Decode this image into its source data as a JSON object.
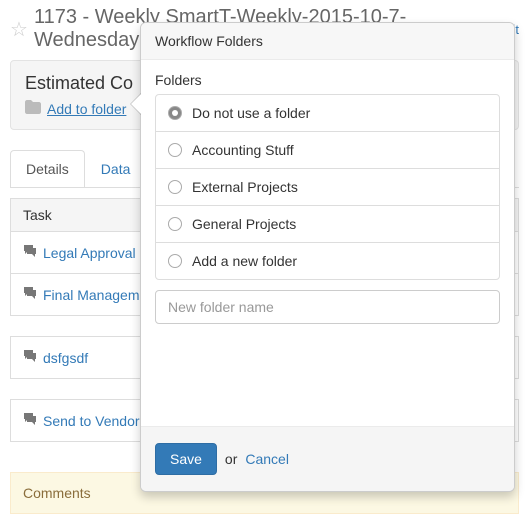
{
  "header": {
    "title": "1173 - Weekly SmartT-Weekly-2015-10-7-Wednesday",
    "edit": "edit"
  },
  "panel": {
    "title": "Estimated Co",
    "addToFolder": "Add to folder"
  },
  "tabs": {
    "details": "Details",
    "data": "Data"
  },
  "taskSection": "Task",
  "tasks": [
    {
      "label": "Legal Approval"
    },
    {
      "label": "Final Management"
    },
    {
      "label": "dsfgsdf"
    },
    {
      "label": "Send to Vendor"
    }
  ],
  "comments": "Comments",
  "popover": {
    "title": "Workflow Folders",
    "groupLabel": "Folders",
    "options": [
      "Do not use a folder",
      "Accounting Stuff",
      "External Projects",
      "General Projects",
      "Add a new folder"
    ],
    "placeholder": "New folder name",
    "save": "Save",
    "or": "or",
    "cancel": "Cancel"
  }
}
